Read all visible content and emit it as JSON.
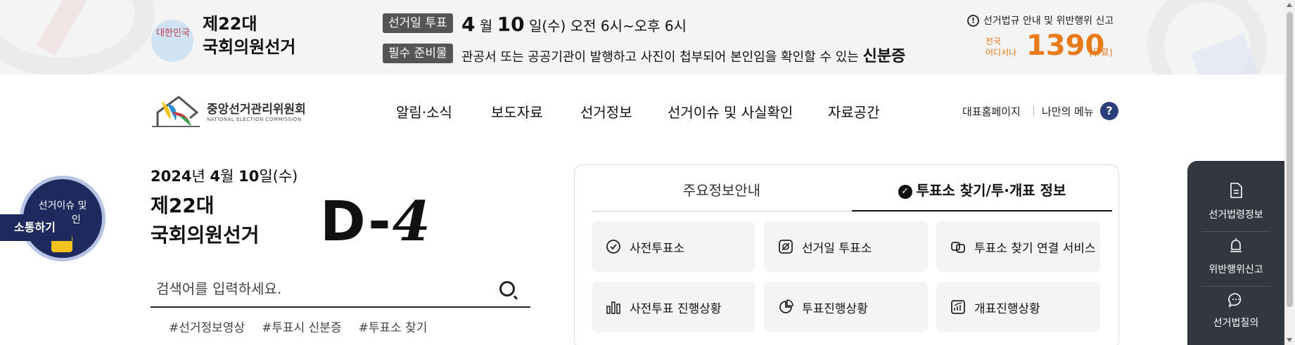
{
  "banner": {
    "emblem_text": "대한민국",
    "title_line1": "제22대",
    "title_line2": "국회의원선거",
    "vote_day_tag": "선거일 투표",
    "vote_month": "4",
    "month_unit": "월",
    "vote_day": "10",
    "vote_rest": "일(수) 오전 6시~오후 6시",
    "required_tag": "필수 준비물",
    "required_text": "관공서 또는 공공기관이 발행하고 사진이 첩부되어 본인임을 확인할 수 있는",
    "required_bold": "신분증",
    "notice": "선거법규 안내 및 위반행위 신고",
    "call_label_1": "전국",
    "call_label_2": "어디서나",
    "call_number": "1390",
    "call_suffix": "(유료)"
  },
  "header": {
    "logo_kr": "중앙선거관리위원회",
    "logo_en": "NATIONAL ELECTION COMMISSION",
    "nav": [
      "알림·소식",
      "보도자료",
      "선거정보",
      "선거이슈 및 사실확인",
      "자료공간"
    ],
    "util_home": "대표홈페이지",
    "util_menu": "나만의 메뉴",
    "help": "?"
  },
  "hero": {
    "date_year": "2024",
    "date_year_unit": "년 ",
    "date_month": "4",
    "date_month_unit": "월 ",
    "date_day": "10",
    "date_day_unit": "일(수)",
    "title_line1": "제22대",
    "title_line2": "국회의원선거",
    "dday_prefix": "D-",
    "dday_num": "4",
    "search_placeholder": "검색어를 입력하세요.",
    "tags": [
      "#선거정보영상",
      "#투표시 신분증",
      "#투표소 찾기"
    ]
  },
  "float_badge": {
    "text_line1": "선거이슈 및",
    "text_line2": "사실확인",
    "tab": "소통하기"
  },
  "panel": {
    "tabs": [
      "주요정보안내",
      "투표소 찾기/투·개표 정보"
    ],
    "cards": [
      "사전투표소",
      "선거일 투표소",
      "투표소 찾기 연결 서비스",
      "사전투표 진행상황",
      "투표진행상황",
      "개표진행상황"
    ]
  },
  "quick_menu": [
    "선거법령정보",
    "위반행위신고",
    "선거법질의"
  ]
}
